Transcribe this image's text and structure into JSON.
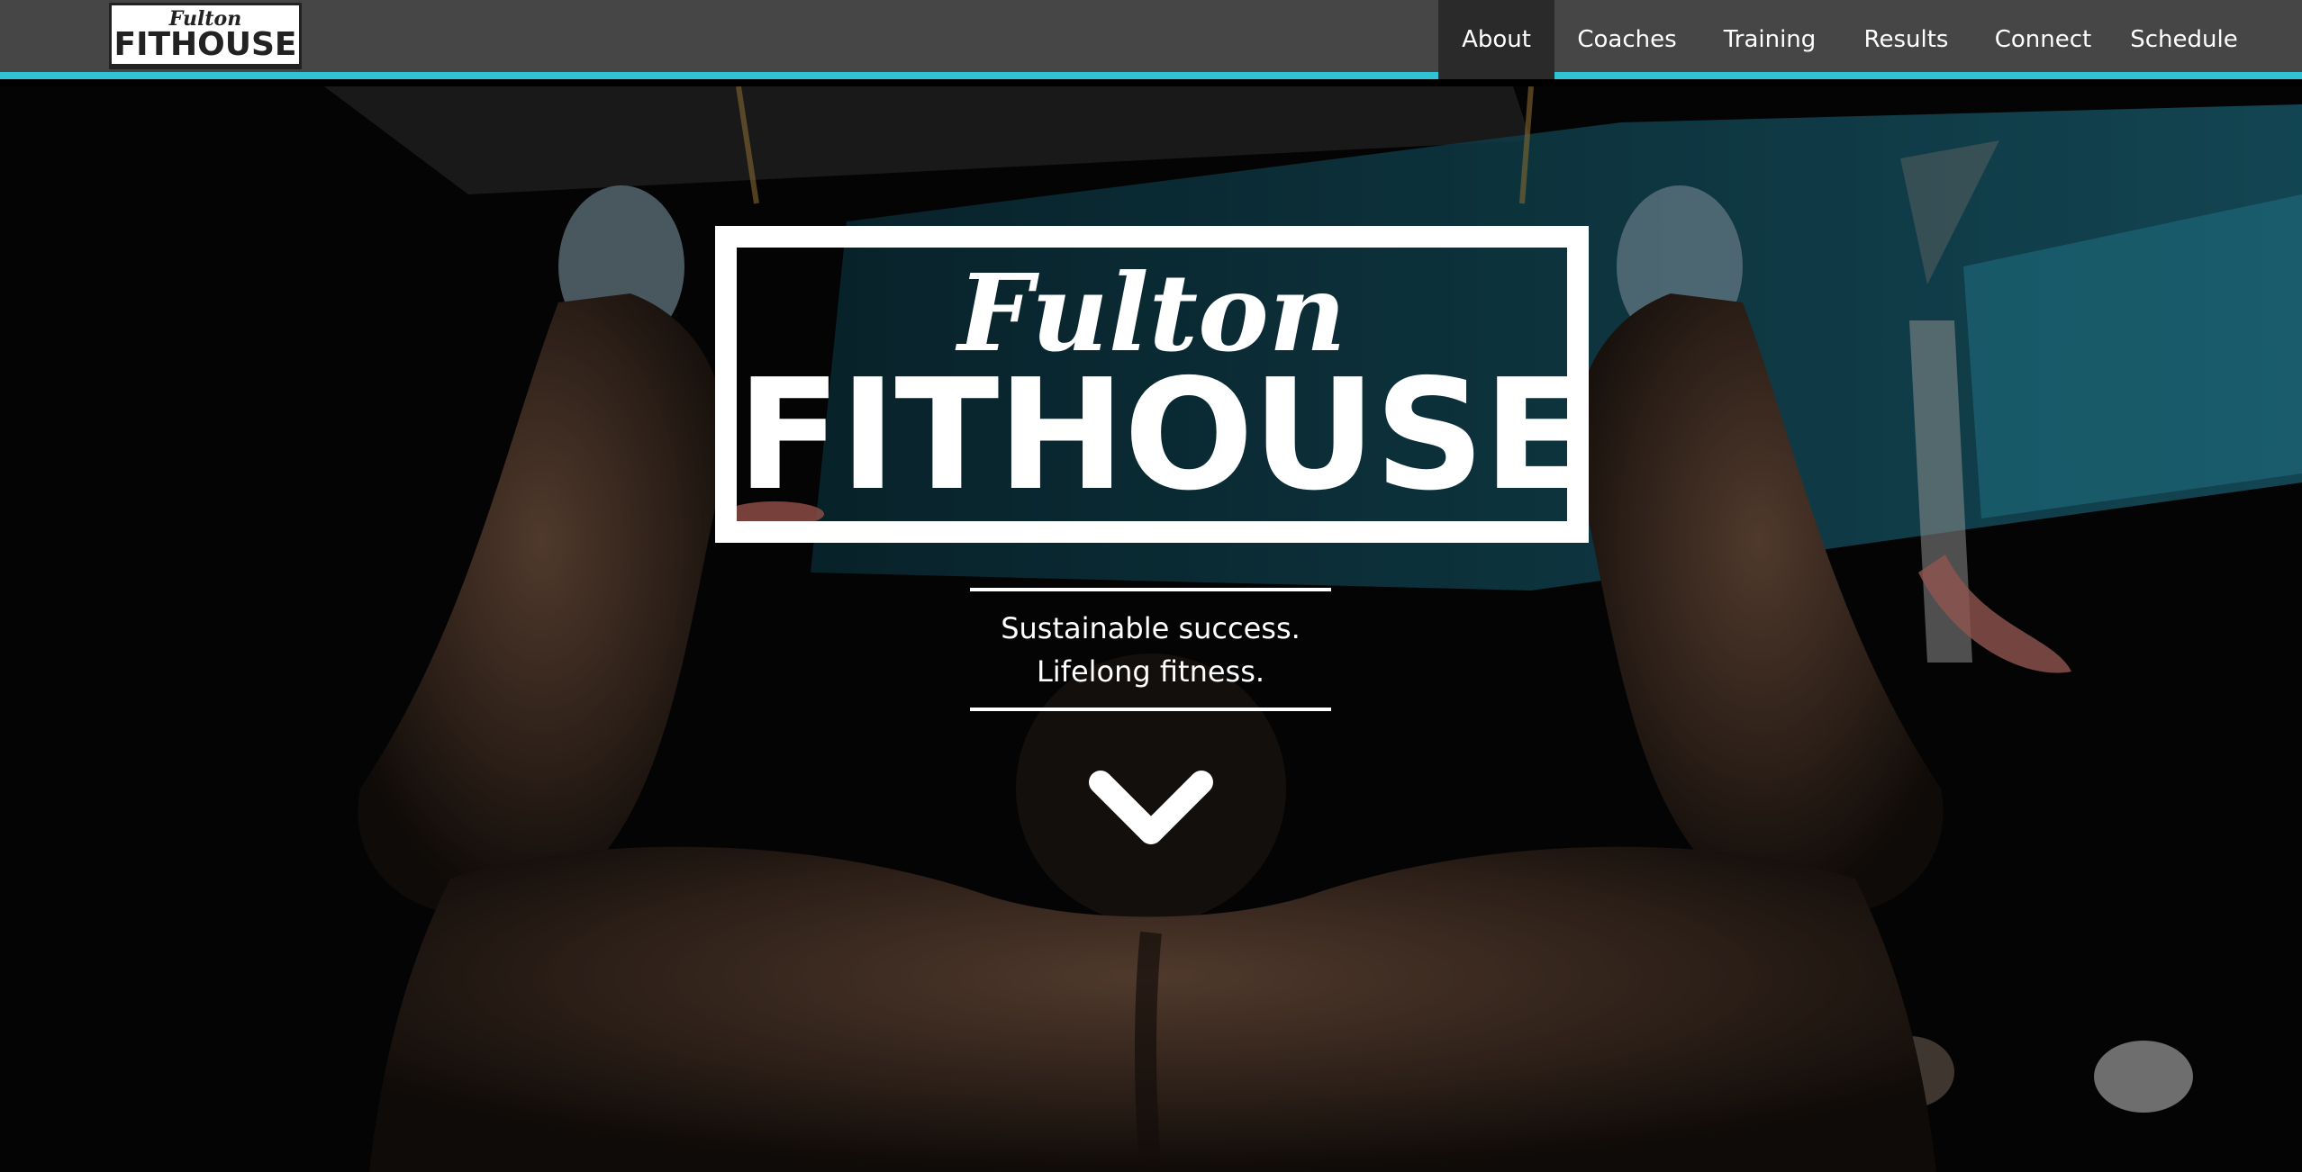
{
  "nav": {
    "logo": {
      "script_text": "Fulton",
      "block_text": "FITHOUSE"
    },
    "items": [
      {
        "label": "About",
        "active": true
      },
      {
        "label": "Coaches"
      },
      {
        "label": "Training"
      },
      {
        "label": "Results"
      },
      {
        "label": "Connect"
      },
      {
        "label": "Schedule"
      }
    ],
    "colors": {
      "bar": "#464646",
      "active": "#2a2a2a",
      "accent_border": "#2fc3d6"
    }
  },
  "hero": {
    "logo": {
      "script_text": "Fulton",
      "block_text": "FITHOUSE"
    },
    "tagline_line1": "Sustainable success.",
    "tagline_line2": "Lifelong fitness.",
    "scroll_icon": "chevron-down-icon",
    "background": "photo of man's back doing pull-ups on gymnastic rings in front of teal climbing wall"
  }
}
